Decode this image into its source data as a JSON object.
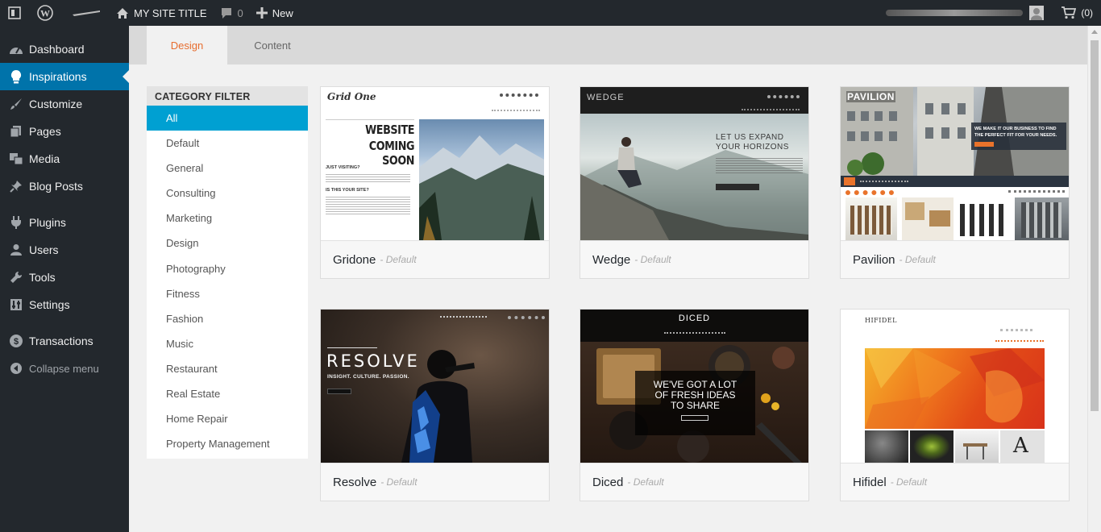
{
  "adminbar": {
    "site_title": "MY SITE TITLE",
    "comments_count": "0",
    "new_label": "New",
    "cart_count": "(0)"
  },
  "sidebar": {
    "items": [
      {
        "label": "Dashboard",
        "icon": "dashboard-icon"
      },
      {
        "label": "Inspirations",
        "icon": "lightbulb-icon"
      },
      {
        "label": "Customize",
        "icon": "brush-icon"
      },
      {
        "label": "Pages",
        "icon": "pages-icon"
      },
      {
        "label": "Media",
        "icon": "media-icon"
      },
      {
        "label": "Blog Posts",
        "icon": "pin-icon"
      },
      {
        "label": "Plugins",
        "icon": "plug-icon"
      },
      {
        "label": "Users",
        "icon": "user-icon"
      },
      {
        "label": "Tools",
        "icon": "wrench-icon"
      },
      {
        "label": "Settings",
        "icon": "settings-icon"
      },
      {
        "label": "Transactions",
        "icon": "transactions-icon"
      },
      {
        "label": "Collapse menu",
        "icon": "collapse-icon"
      }
    ],
    "active_color": "#0073aa"
  },
  "tabs": {
    "design": "Design",
    "content": "Content",
    "active_color": "#e76d2f"
  },
  "category_filter": {
    "title": "CATEGORY FILTER",
    "items": [
      "All",
      "Default",
      "General",
      "Consulting",
      "Marketing",
      "Design",
      "Photography",
      "Fitness",
      "Fashion",
      "Music",
      "Restaurant",
      "Real Estate",
      "Home Repair",
      "Property Management"
    ],
    "active_color": "#00a0d2"
  },
  "themes": [
    {
      "name": "Gridone",
      "tag": "- Default",
      "preview": {
        "logo": "Grid One",
        "heading1": "WEBSITE",
        "heading2": "COMING SOON",
        "sub1": "JUST VISITING?",
        "sub2": "IS THIS YOUR SITE?"
      }
    },
    {
      "name": "Wedge",
      "tag": "- Default",
      "preview": {
        "logo": "WEDGE",
        "heading1": "LET US EXPAND",
        "heading2": "YOUR HORIZONS"
      }
    },
    {
      "name": "Pavilion",
      "tag": "- Default",
      "preview": {
        "logo": "PAVILION",
        "heading1": "WE MAKE IT OUR BUSINESS TO FIND",
        "heading2": "THE PERFECT FIT FOR YOUR NEEDS."
      }
    },
    {
      "name": "Resolve",
      "tag": "- Default",
      "preview": {
        "logo": "RESOLVE",
        "heading1": "INSIGHT. CULTURE. PASSION."
      }
    },
    {
      "name": "Diced",
      "tag": "- Default",
      "preview": {
        "logo": "DICED",
        "heading1": "WE'VE GOT A LOT",
        "heading2": "OF FRESH IDEAS",
        "heading3": "TO SHARE"
      }
    },
    {
      "name": "Hifidel",
      "tag": "- Default",
      "preview": {
        "logo": "HIFIDEL"
      }
    }
  ]
}
